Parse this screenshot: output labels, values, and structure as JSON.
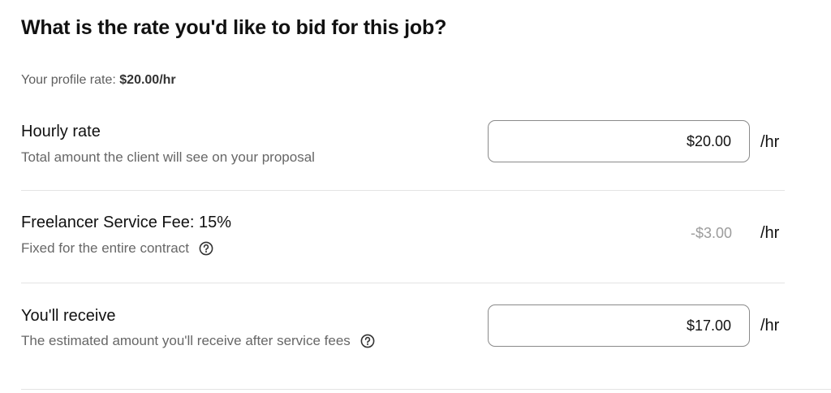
{
  "heading": "What is the rate you'd like to bid for this job?",
  "profile_rate": {
    "label": "Your profile rate:",
    "value": "$20.00/hr"
  },
  "hourly_rate": {
    "label": "Hourly rate",
    "description": "Total amount the client will see on your proposal",
    "value": "$20.00",
    "unit": "/hr"
  },
  "service_fee": {
    "label": "Freelancer Service Fee: 15%",
    "description": "Fixed for the entire contract",
    "amount": "-$3.00",
    "unit": "/hr"
  },
  "receive": {
    "label": "You'll receive",
    "description": "The estimated amount you'll receive after service fees",
    "value": "$17.00",
    "unit": "/hr"
  },
  "icons": {
    "help": "question-circle-icon"
  }
}
